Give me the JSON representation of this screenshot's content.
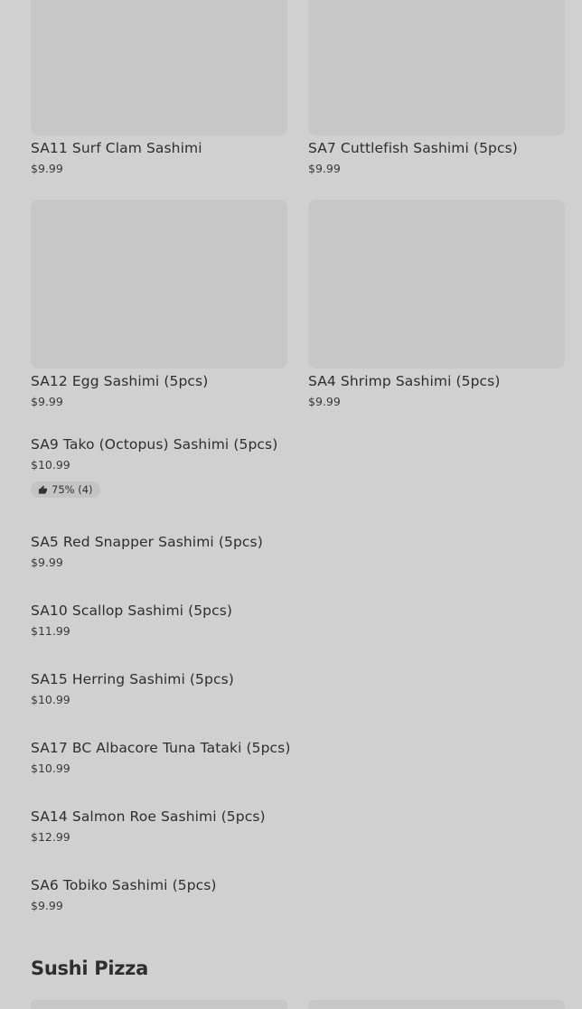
{
  "grid_items": [
    {
      "name": "SA11 Surf Clam Sashimi",
      "price": "$9.99"
    },
    {
      "name": "SA7 Cuttlefish Sashimi (5pcs)",
      "price": "$9.99"
    },
    {
      "name": "SA12 Egg Sashimi (5pcs)",
      "price": "$9.99"
    },
    {
      "name": "SA4 Shrimp Sashimi (5pcs)",
      "price": "$9.99"
    }
  ],
  "list_items": [
    {
      "name": "SA9 Tako (Octopus) Sashimi (5pcs)",
      "price": "$10.99",
      "rating": "75% (4)"
    },
    {
      "name": "SA5 Red Snapper Sashimi (5pcs)",
      "price": "$9.99"
    },
    {
      "name": "SA10 Scallop Sashimi (5pcs)",
      "price": "$11.99"
    },
    {
      "name": "SA15 Herring Sashimi (5pcs)",
      "price": "$10.99"
    },
    {
      "name": "SA17 BC Albacore Tuna Tataki (5pcs)",
      "price": "$10.99"
    },
    {
      "name": "SA14 Salmon Roe Sashimi (5pcs)",
      "price": "$12.99"
    },
    {
      "name": "SA6 Tobiko Sashimi (5pcs)",
      "price": "$9.99"
    }
  ],
  "section": {
    "title": "Sushi Pizza"
  },
  "icons": {
    "rating": "thumbs-up-icon"
  }
}
